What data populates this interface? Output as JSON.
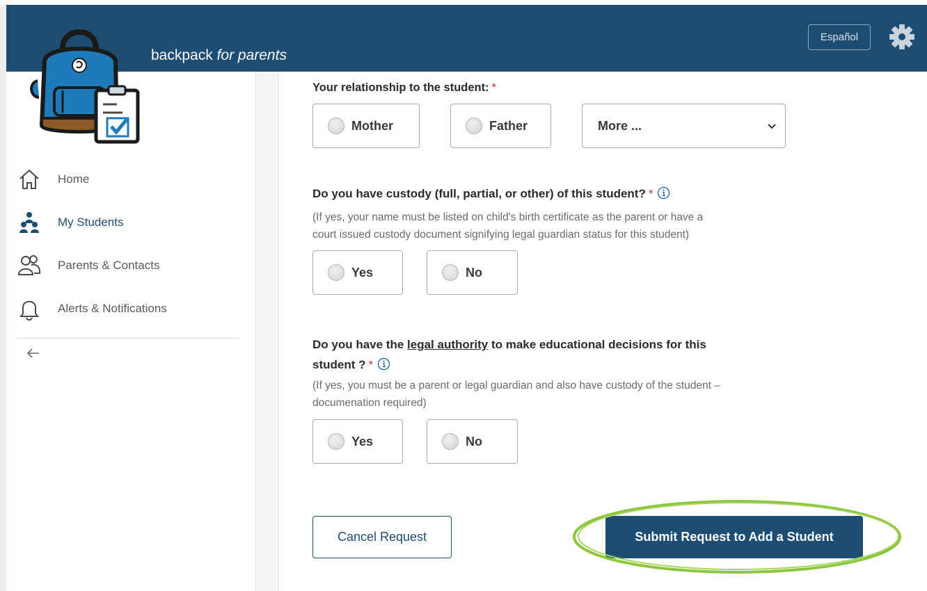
{
  "header": {
    "title_main": "backpack ",
    "title_em": "for parents",
    "language_button": "Español",
    "settings_icon": "gear-icon",
    "color": "#1d4d72"
  },
  "sidebar": {
    "items": [
      {
        "label": "Home",
        "icon": "home-icon"
      },
      {
        "label": "My Students",
        "icon": "students-icon",
        "active": true
      },
      {
        "label": "Parents & Contacts",
        "icon": "contacts-icon"
      },
      {
        "label": "Alerts & Notifications",
        "icon": "bell-icon"
      }
    ],
    "collapse_icon": "arrow-left-icon"
  },
  "form": {
    "relationship": {
      "label": "Your relationship to the student:",
      "required_mark": "*",
      "options": [
        "Mother",
        "Father"
      ],
      "select_value": "More ..."
    },
    "custody": {
      "label": "Do you have custody (full, partial, or other) of this student?",
      "required_mark": "*",
      "hint_line1": "(If yes, your name must be listed on child's birth certificate as the parent or have a",
      "hint_line2": "court issued custody document signifying legal guardian status for this student)",
      "options": [
        "Yes",
        "No"
      ]
    },
    "legal_authority": {
      "label_pre": "Do you have the ",
      "label_link": "legal authority",
      "label_post": " to make educational decisions for this",
      "label_line2": "student ?",
      "required_mark": "*",
      "hint_line1": "(If yes, you must be a parent or legal guardian and also have custody of the student –",
      "hint_line2": "documenation required)",
      "options": [
        "Yes",
        "No"
      ]
    },
    "cancel_label": "Cancel Request",
    "submit_label": "Submit Request to Add a Student",
    "highlight_color": "#8cc63f"
  }
}
